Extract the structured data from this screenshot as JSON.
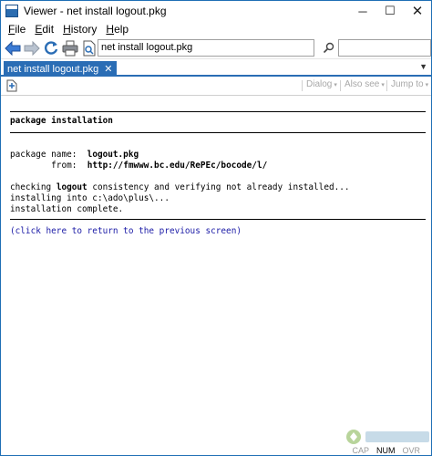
{
  "window": {
    "title": "Viewer - net install logout.pkg",
    "icon": "viewer-app-icon",
    "controls": {
      "minimize": "─",
      "maximize": "☐",
      "close": "✕"
    }
  },
  "menu": {
    "items": [
      {
        "underline": "F",
        "rest": "ile"
      },
      {
        "underline": "E",
        "rest": "dit"
      },
      {
        "underline": "H",
        "rest": "istory"
      },
      {
        "underline": "H",
        "rest": "elp"
      }
    ]
  },
  "toolbar": {
    "address": "net install logout.pkg",
    "search_placeholder": "",
    "icons": [
      "back-arrow-icon",
      "forward-arrow-icon",
      "refresh-icon",
      "print-icon",
      "find-icon",
      "search-go-icon"
    ]
  },
  "tabs": [
    {
      "label": "net install logout.pkg",
      "close": "✕"
    }
  ],
  "subbar": {
    "dialog": "Dialog",
    "also_see": "Also see",
    "jump_to": "Jump to",
    "caret": "▾"
  },
  "content": {
    "heading": "package installation",
    "pkg_name_label": "package name:",
    "pkg_name_value": "logout.pkg",
    "from_label": "from:",
    "from_value": "http://fmwww.bc.edu/RePEc/bocode/l/",
    "checking_prefix": "checking ",
    "checking_pkg": "logout",
    "checking_suffix": " consistency and verifying not already installed...",
    "installing": "installing into c:\\ado\\plus\\...",
    "complete": "installation complete.",
    "return_link": "(click here to return to the previous screen)"
  },
  "status": {
    "cap": "CAP",
    "num": "NUM",
    "ovr": "OVR"
  },
  "colors": {
    "accent": "#2a6db5",
    "link": "#1a1aa6",
    "disabled": "#a8a8a8"
  }
}
